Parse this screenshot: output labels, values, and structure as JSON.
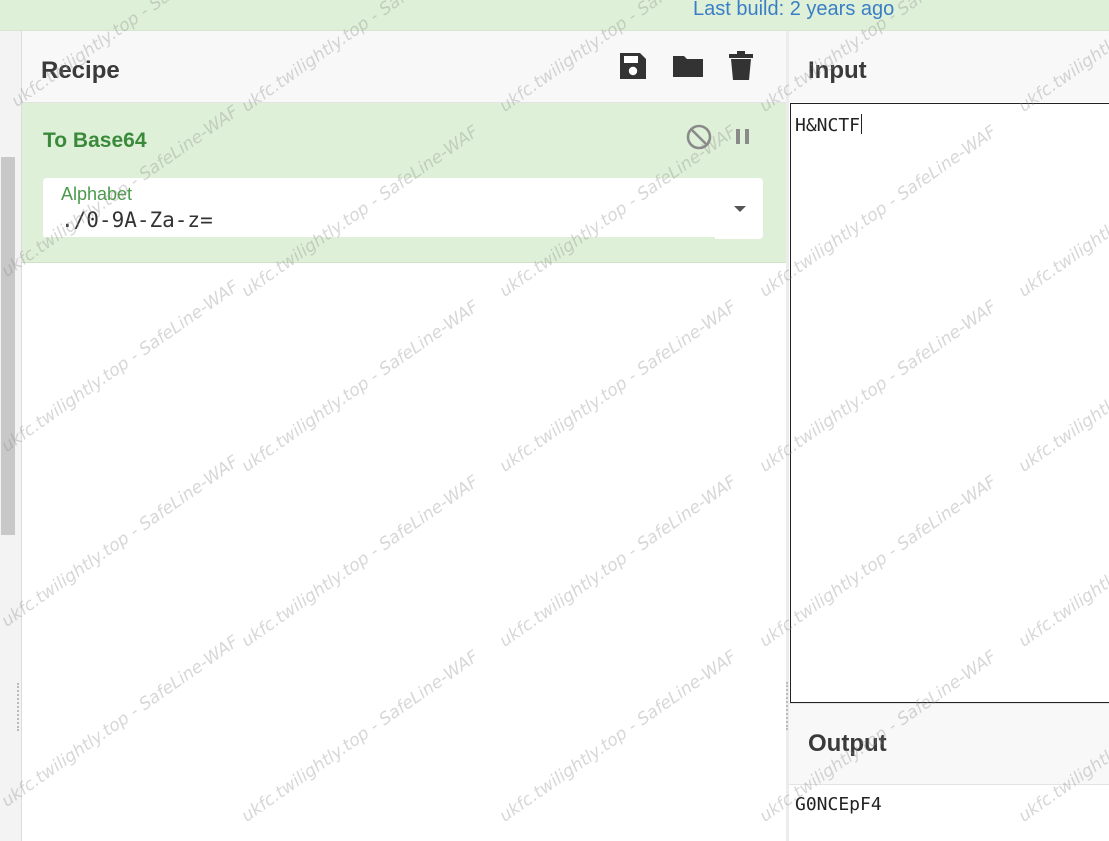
{
  "topbar": {
    "last_build": "Last build: 2 years ago"
  },
  "recipe": {
    "title": "Recipe",
    "icons": [
      "save-icon",
      "folder-icon",
      "trash-icon"
    ],
    "operation": {
      "name": "To Base64",
      "alphabet_label": "Alphabet",
      "alphabet_value": "./0-9A-Za-z="
    }
  },
  "input": {
    "title": "Input",
    "value": "H&NCTF"
  },
  "output": {
    "title": "Output",
    "value": "G0NCEpF4"
  },
  "watermark": {
    "text": "ukfc.twilightly.top - SafeLine-WAF"
  },
  "colors": {
    "accent_green": "#3b8a3b",
    "op_background": "#dff0d8",
    "link_blue": "#3a7ec6"
  }
}
